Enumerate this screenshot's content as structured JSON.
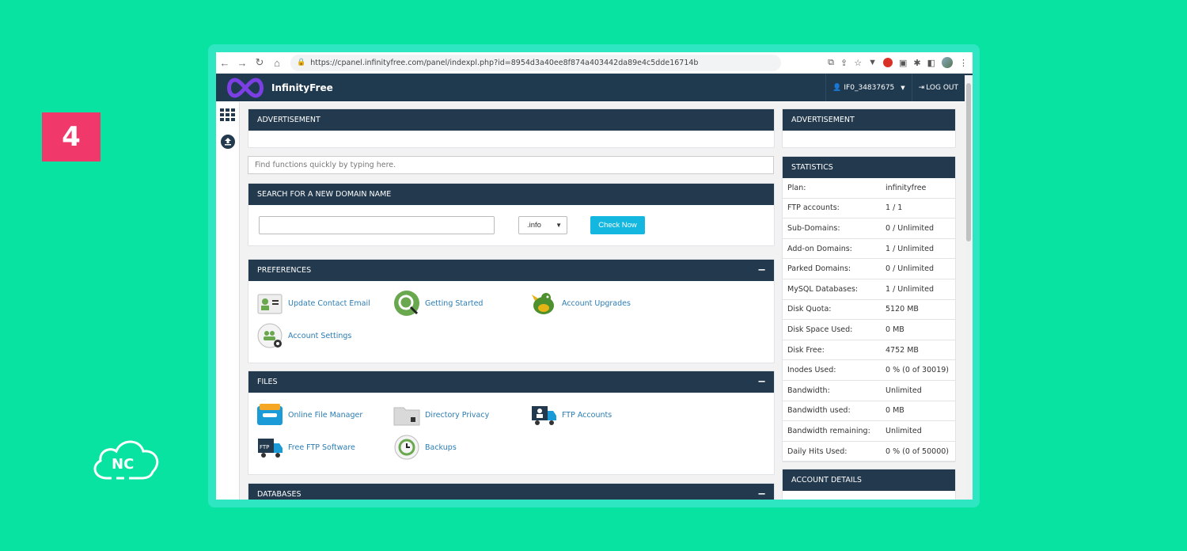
{
  "step_number": "4",
  "brand_logo_text": "NC",
  "browser": {
    "url": "https://cpanel.infinityfree.com/panel/indexpl.php?id=8954d3a40ee8f874a403442da89e4c5dde16714b"
  },
  "header": {
    "logo_text": "InfinityFree",
    "username": "IF0_34837675",
    "logout_label": "LOG OUT"
  },
  "advert_main": {
    "title": "ADVERTISEMENT"
  },
  "advert_side": {
    "title": "ADVERTISEMENT"
  },
  "search": {
    "placeholder": "Find functions quickly by typing here."
  },
  "domain_search": {
    "title": "SEARCH FOR A NEW DOMAIN NAME",
    "tld_value": ".info",
    "button_label": "Check Now"
  },
  "preferences": {
    "title": "PREFERENCES",
    "items": [
      "Update Contact Email",
      "Getting Started",
      "Account Upgrades",
      "Account Settings"
    ]
  },
  "files": {
    "title": "FILES",
    "items": [
      "Online File Manager",
      "Directory Privacy",
      "FTP Accounts",
      "Free FTP Software",
      "Backups"
    ]
  },
  "databases": {
    "title": "DATABASES"
  },
  "statistics": {
    "title": "STATISTICS",
    "rows": [
      {
        "label": "Plan:",
        "value": "infinityfree"
      },
      {
        "label": "FTP accounts:",
        "value": "1 / 1"
      },
      {
        "label": "Sub-Domains:",
        "value": "0 / Unlimited"
      },
      {
        "label": "Add-on Domains:",
        "value": "1 / Unlimited"
      },
      {
        "label": "Parked Domains:",
        "value": "0 / Unlimited"
      },
      {
        "label": "MySQL Databases:",
        "value": "1 / Unlimited"
      },
      {
        "label": "Disk Quota:",
        "value": "5120 MB"
      },
      {
        "label": "Disk Space Used:",
        "value": "0 MB"
      },
      {
        "label": "Disk Free:",
        "value": "4752 MB"
      },
      {
        "label": "Inodes Used:",
        "value": "0 % (0 of 30019)"
      },
      {
        "label": "Bandwidth:",
        "value": "Unlimited"
      },
      {
        "label": "Bandwidth used:",
        "value": "0 MB"
      },
      {
        "label": "Bandwidth remaining:",
        "value": "Unlimited"
      },
      {
        "label": "Daily Hits Used:",
        "value": "0 % (0 of 50000)"
      }
    ]
  },
  "account_details": {
    "title": "ACCOUNT DETAILS"
  },
  "colors": {
    "background": "#08e3a1",
    "panel_header": "#23394d",
    "accent": "#13b7e0",
    "badge": "#f0386b"
  }
}
